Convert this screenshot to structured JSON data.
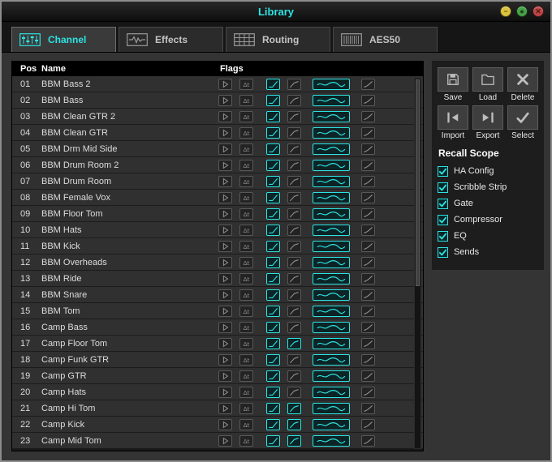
{
  "window": {
    "title": "Library",
    "controls": [
      {
        "name": "minimize",
        "glyph": "−",
        "color": "#ddc23e"
      },
      {
        "name": "maximize",
        "glyph": "●",
        "color": "#46a046"
      },
      {
        "name": "close",
        "glyph": "✕",
        "color": "#c04545"
      }
    ]
  },
  "tabs": [
    {
      "label": "Channel",
      "icon": "channel-strip-icon",
      "active": true
    },
    {
      "label": "Effects",
      "icon": "effects-wave-icon",
      "active": false
    },
    {
      "label": "Routing",
      "icon": "routing-grid-icon",
      "active": false
    },
    {
      "label": "AES50",
      "icon": "aes50-ports-icon",
      "active": false
    }
  ],
  "table": {
    "headers": {
      "pos": "Pos",
      "name": "Name",
      "flags": "Flags"
    },
    "flag_legend": [
      "preview",
      "delay",
      "gate",
      "compressor",
      "eq",
      "sends"
    ],
    "rows": [
      {
        "pos": "01",
        "name": "BBM Bass 2",
        "flags": [
          0,
          0,
          1,
          0,
          1,
          0
        ]
      },
      {
        "pos": "02",
        "name": "BBM Bass",
        "flags": [
          0,
          0,
          1,
          0,
          1,
          0
        ]
      },
      {
        "pos": "03",
        "name": "BBM Clean GTR 2",
        "flags": [
          0,
          0,
          1,
          0,
          1,
          0
        ]
      },
      {
        "pos": "04",
        "name": "BBM Clean GTR",
        "flags": [
          0,
          0,
          1,
          0,
          1,
          0
        ]
      },
      {
        "pos": "05",
        "name": "BBM Drm Mid Side",
        "flags": [
          0,
          0,
          1,
          0,
          1,
          0
        ]
      },
      {
        "pos": "06",
        "name": "BBM Drum Room 2",
        "flags": [
          0,
          0,
          1,
          0,
          1,
          0
        ]
      },
      {
        "pos": "07",
        "name": "BBM Drum Room",
        "flags": [
          0,
          0,
          1,
          0,
          1,
          0
        ]
      },
      {
        "pos": "08",
        "name": "BBM Female Vox",
        "flags": [
          0,
          0,
          1,
          0,
          1,
          0
        ]
      },
      {
        "pos": "09",
        "name": "BBM Floor Tom",
        "flags": [
          0,
          0,
          1,
          0,
          1,
          0
        ]
      },
      {
        "pos": "10",
        "name": "BBM Hats",
        "flags": [
          0,
          0,
          1,
          0,
          1,
          0
        ]
      },
      {
        "pos": "11",
        "name": "BBM Kick",
        "flags": [
          0,
          0,
          1,
          0,
          1,
          0
        ]
      },
      {
        "pos": "12",
        "name": "BBM Overheads",
        "flags": [
          0,
          0,
          1,
          0,
          1,
          0
        ]
      },
      {
        "pos": "13",
        "name": "BBM Ride",
        "flags": [
          0,
          0,
          1,
          0,
          1,
          0
        ]
      },
      {
        "pos": "14",
        "name": "BBM Snare",
        "flags": [
          0,
          0,
          1,
          0,
          1,
          0
        ]
      },
      {
        "pos": "15",
        "name": "BBM Tom",
        "flags": [
          0,
          0,
          1,
          0,
          1,
          0
        ]
      },
      {
        "pos": "16",
        "name": "Camp Bass",
        "flags": [
          0,
          0,
          1,
          0,
          1,
          0
        ]
      },
      {
        "pos": "17",
        "name": "Camp Floor Tom",
        "flags": [
          0,
          0,
          1,
          1,
          1,
          0
        ]
      },
      {
        "pos": "18",
        "name": "Camp Funk GTR",
        "flags": [
          0,
          0,
          1,
          0,
          1,
          0
        ]
      },
      {
        "pos": "19",
        "name": "Camp GTR",
        "flags": [
          0,
          0,
          1,
          0,
          1,
          0
        ]
      },
      {
        "pos": "20",
        "name": "Camp Hats",
        "flags": [
          0,
          0,
          1,
          0,
          1,
          0
        ]
      },
      {
        "pos": "21",
        "name": "Camp Hi Tom",
        "flags": [
          0,
          0,
          1,
          1,
          1,
          0
        ]
      },
      {
        "pos": "22",
        "name": "Camp Kick",
        "flags": [
          0,
          0,
          1,
          1,
          1,
          0
        ]
      },
      {
        "pos": "23",
        "name": "Camp Mid Tom",
        "flags": [
          0,
          0,
          1,
          1,
          1,
          0
        ]
      }
    ]
  },
  "actions": [
    {
      "label": "Save",
      "icon": "save-icon"
    },
    {
      "label": "Load",
      "icon": "load-icon"
    },
    {
      "label": "Delete",
      "icon": "delete-icon"
    },
    {
      "label": "Import",
      "icon": "import-icon"
    },
    {
      "label": "Export",
      "icon": "export-icon"
    },
    {
      "label": "Select",
      "icon": "select-icon"
    }
  ],
  "recall_scope": {
    "title": "Recall Scope",
    "items": [
      {
        "label": "HA Config",
        "checked": true
      },
      {
        "label": "Scribble Strip",
        "checked": true
      },
      {
        "label": "Gate",
        "checked": true
      },
      {
        "label": "Compressor",
        "checked": true
      },
      {
        "label": "EQ",
        "checked": true
      },
      {
        "label": "Sends",
        "checked": true
      }
    ]
  },
  "colors": {
    "accent": "#2ee2e2"
  }
}
